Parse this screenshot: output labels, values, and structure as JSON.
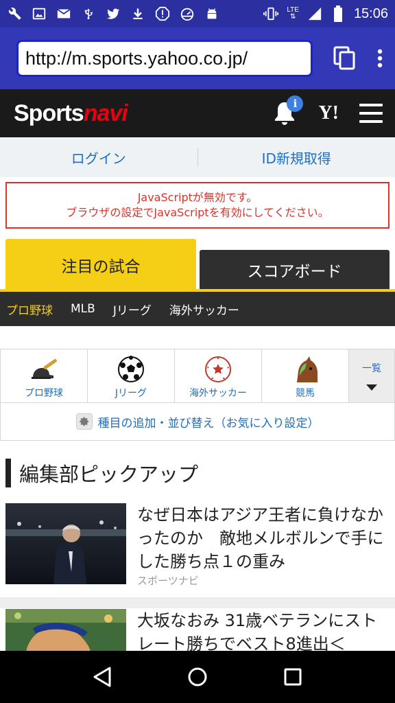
{
  "status_bar": {
    "time": "15:06",
    "network": "LTE",
    "icons_left": [
      "wrench-icon",
      "image-icon",
      "mail-icon",
      "usb-icon",
      "twitter-icon",
      "download-icon",
      "alert-icon",
      "speedometer-icon",
      "android-icon"
    ],
    "icons_right": [
      "vibrate-icon",
      "signal-icon",
      "battery-icon"
    ]
  },
  "browser": {
    "url": "http://m.sports.yahoo.co.jp/"
  },
  "header": {
    "logo_part1": "Sports",
    "logo_part2": "navi",
    "notification_badge": "i",
    "yahoo_logo": "Y!"
  },
  "auth": {
    "login": "ログイン",
    "register": "ID新規取得"
  },
  "warning": {
    "line1": "JavaScriptが無効です。",
    "line2": "ブラウザの設定でJavaScriptを有効にしてください。"
  },
  "tabs": {
    "focus": "注目の試合",
    "scoreboard": "スコアボード"
  },
  "sport_nav": [
    "プロ野球",
    "MLB",
    "Jリーグ",
    "海外サッカー"
  ],
  "sports": {
    "items": [
      {
        "label": "プロ野球",
        "icon": "baseball-icon"
      },
      {
        "label": "Jリーグ",
        "icon": "soccer-ball-icon"
      },
      {
        "label": "海外サッカー",
        "icon": "star-ball-icon"
      },
      {
        "label": "競馬",
        "icon": "horse-icon"
      }
    ],
    "all_label": "一覧",
    "settings_label": "種目の追加・並び替え（お気に入り設定）"
  },
  "section": {
    "title": "編集部ピックアップ"
  },
  "articles": [
    {
      "headline": "なぜ日本はアジア王者に負けなかったのか　敵地メルボルンで手にした勝ち点１の重み",
      "source": "スポーツナビ"
    },
    {
      "headline": "大坂なおみ 31歳ベテランにストレート勝ちでベスト8進出＜",
      "source": ""
    }
  ],
  "colors": {
    "status_bar": "#2b2fa0",
    "url_bar": "#3238b6",
    "accent_yellow": "#f5cf15",
    "link_blue": "#1f6fbf",
    "warning_red": "#d9342b"
  }
}
